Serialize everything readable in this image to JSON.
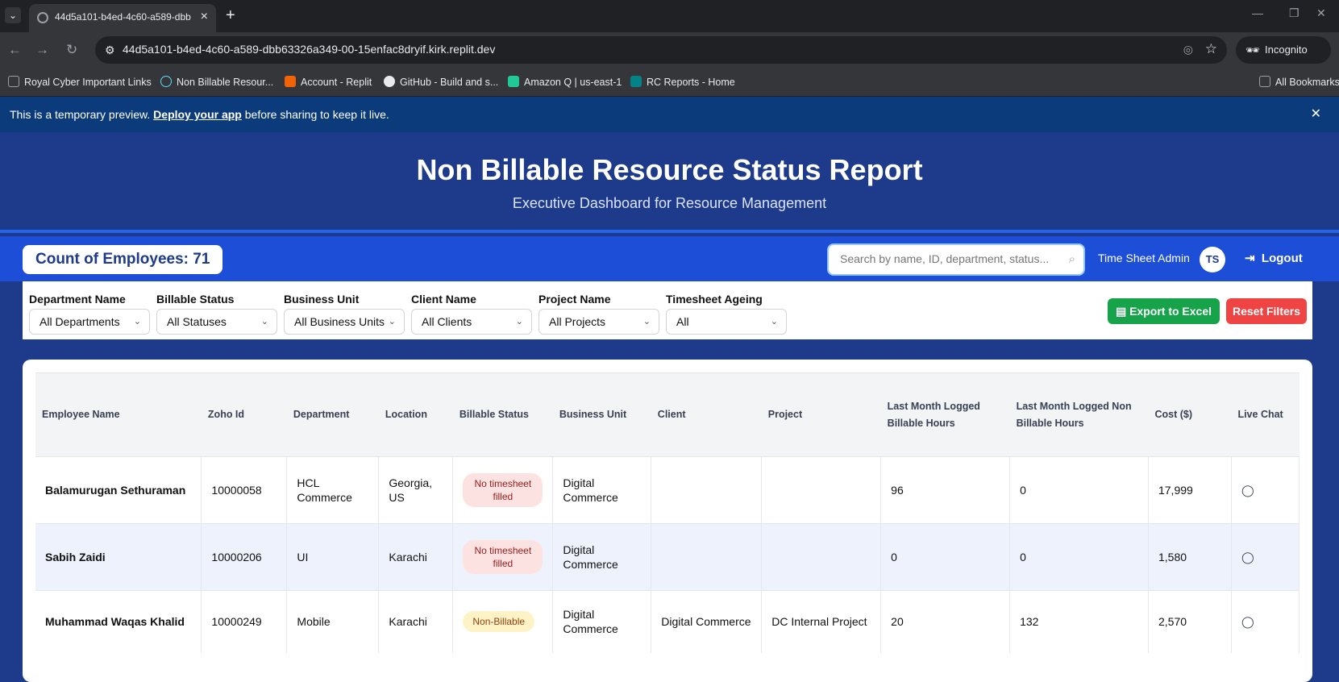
{
  "browser": {
    "tab_title": "44d5a101-b4ed-4c60-a589-dbb",
    "url": "44d5a101-b4ed-4c60-a589-dbb63326a349-00-15enfac8dryif.kirk.replit.dev",
    "incognito_label": "Incognito",
    "bookmarks": [
      {
        "label": "Royal Cyber Important Links",
        "icon": "folder-icon"
      },
      {
        "label": "Non Billable Resour...",
        "icon": "react-icon"
      },
      {
        "label": "Account - Replit",
        "icon": "replit-icon"
      },
      {
        "label": "GitHub - Build and s...",
        "icon": "github-icon"
      },
      {
        "label": "Amazon Q | us-east-1",
        "icon": "amazon-q-icon"
      },
      {
        "label": "RC Reports - Home",
        "icon": "sharepoint-icon"
      }
    ],
    "all_bookmarks": "All Bookmarks"
  },
  "preview_banner": {
    "text_before": "This is a temporary preview. ",
    "link": "Deploy your app",
    "text_after": " before sharing to keep it live."
  },
  "header": {
    "title": "Non Billable Resource Status Report",
    "subtitle": "Executive Dashboard for Resource Management"
  },
  "toolbar": {
    "count_label": "Count of Employees: 71",
    "search_placeholder": "Search by name, ID, department, status...",
    "user_name": "Time Sheet Admin",
    "avatar_initials": "TS",
    "logout_label": "Logout"
  },
  "filters": [
    {
      "label": "Department Name",
      "value": "All Departments"
    },
    {
      "label": "Billable Status",
      "value": "All Statuses"
    },
    {
      "label": "Business Unit",
      "value": "All Business Units"
    },
    {
      "label": "Client Name",
      "value": "All Clients"
    },
    {
      "label": "Project Name",
      "value": "All Projects"
    },
    {
      "label": "Timesheet Ageing",
      "value": "All"
    }
  ],
  "actions": {
    "export_label": "Export to Excel",
    "reset_label": "Reset Filters"
  },
  "table": {
    "columns": [
      "Employee Name",
      "Zoho Id",
      "Department",
      "Location",
      "Billable Status",
      "Business Unit",
      "Client",
      "Project",
      "Last Month Logged Billable Hours",
      "Last Month Logged Non Billable Hours",
      "Cost ($)",
      "Live Chat"
    ],
    "rows": [
      {
        "name": "Balamurugan Sethuraman",
        "zoho_id": "10000058",
        "department": "HCL Commerce",
        "location": "Georgia, US",
        "status": "No timesheet filled",
        "status_color": "red",
        "business_unit": "Digital Commerce",
        "client": "",
        "project": "",
        "billable_hours": "96",
        "non_billable_hours": "0",
        "cost": "17,999"
      },
      {
        "name": "Sabih Zaidi",
        "zoho_id": "10000206",
        "department": "UI",
        "location": "Karachi",
        "status": "No timesheet filled",
        "status_color": "red",
        "business_unit": "Digital Commerce",
        "client": "",
        "project": "",
        "billable_hours": "0",
        "non_billable_hours": "0",
        "cost": "1,580"
      },
      {
        "name": "Muhammad Waqas Khalid",
        "zoho_id": "10000249",
        "department": "Mobile",
        "location": "Karachi",
        "status": "Non-Billable",
        "status_color": "yellow",
        "business_unit": "Digital Commerce",
        "client": "Digital Commerce",
        "project": "DC Internal Project",
        "billable_hours": "20",
        "non_billable_hours": "132",
        "cost": "2,570"
      }
    ]
  },
  "colors": {
    "primary": "#1e3a8a",
    "accent": "#1d4ed8",
    "export": "#16a34a",
    "reset": "#ef4444"
  }
}
